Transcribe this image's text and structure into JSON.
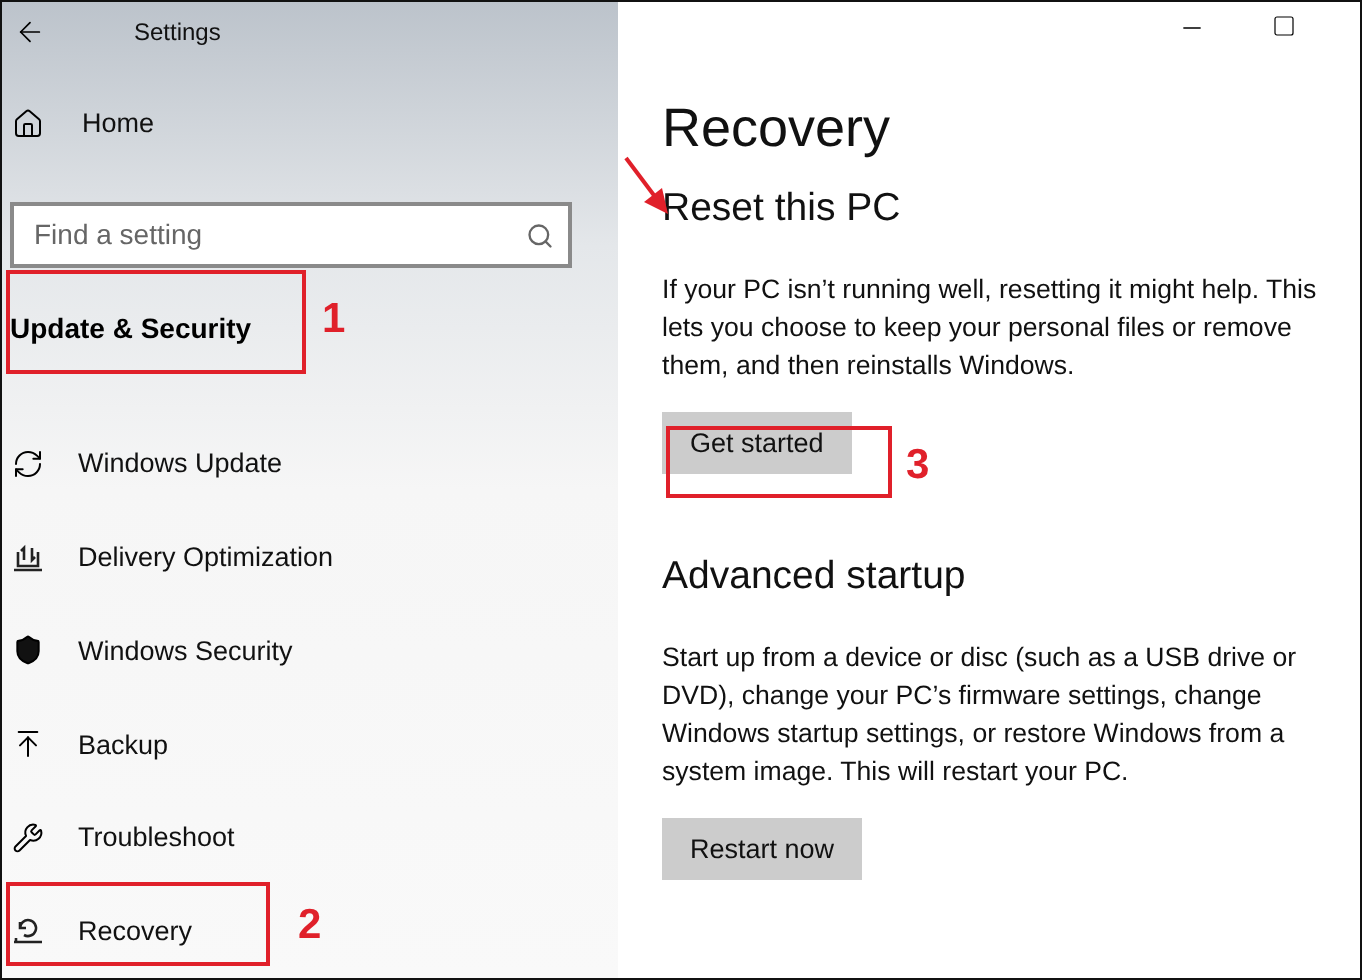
{
  "window": {
    "title": "Settings"
  },
  "sidebar": {
    "home": "Home",
    "search": {
      "placeholder": "Find a setting"
    },
    "section": "Update & Security",
    "items": [
      {
        "label": "Windows Update"
      },
      {
        "label": "Delivery Optimization"
      },
      {
        "label": "Windows Security"
      },
      {
        "label": "Backup"
      },
      {
        "label": "Troubleshoot"
      },
      {
        "label": "Recovery"
      }
    ]
  },
  "content": {
    "title": "Recovery",
    "sections": [
      {
        "heading": "Reset this PC",
        "text": "If your PC isn’t running well, resetting it might help. This lets you choose to keep your personal files or remove them, and then reinstalls Windows.",
        "button": "Get started"
      },
      {
        "heading": "Advanced startup",
        "text": "Start up from a device or disc (such as a USB drive or DVD), change your PC’s firmware settings, change Windows startup settings, or restore Windows from a system image. This will restart your PC.",
        "button": "Restart now"
      }
    ]
  },
  "annotations": [
    {
      "number": "1"
    },
    {
      "number": "2"
    },
    {
      "number": "3"
    }
  ]
}
